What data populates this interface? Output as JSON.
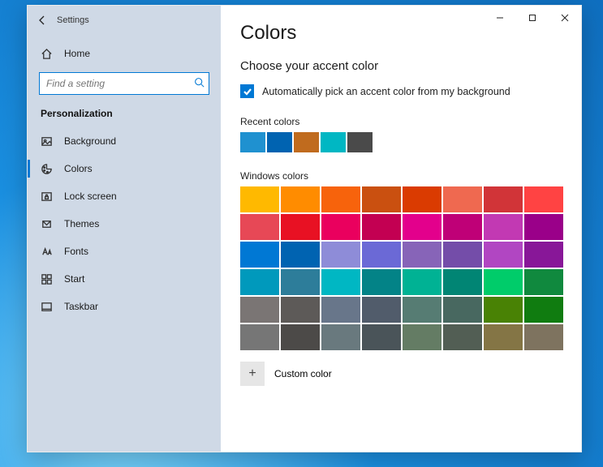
{
  "window": {
    "title": "Settings"
  },
  "sidebar": {
    "home": "Home",
    "search_placeholder": "Find a setting",
    "section": "Personalization",
    "items": [
      {
        "label": "Background"
      },
      {
        "label": "Colors"
      },
      {
        "label": "Lock screen"
      },
      {
        "label": "Themes"
      },
      {
        "label": "Fonts"
      },
      {
        "label": "Start"
      },
      {
        "label": "Taskbar"
      }
    ]
  },
  "page": {
    "heading": "Colors",
    "subheading": "Choose your accent color",
    "auto_pick_label": "Automatically pick an accent color from my background",
    "auto_pick_checked": true,
    "recent_label": "Recent colors",
    "recent_colors": [
      "#1f91d0",
      "#0063b1",
      "#c06b1e",
      "#00b7c3",
      "#4a4a4a"
    ],
    "windows_label": "Windows colors",
    "windows_colors": [
      "#ffb900",
      "#ff8c00",
      "#f7630c",
      "#ca5010",
      "#da3b01",
      "#ef6950",
      "#d13438",
      "#ff4343",
      "#e74856",
      "#e81123",
      "#ea005e",
      "#c30052",
      "#e3008c",
      "#bf0077",
      "#c239b3",
      "#9a0089",
      "#0078d4",
      "#0063b1",
      "#8e8cd8",
      "#6b69d6",
      "#8764b8",
      "#744da9",
      "#b146c2",
      "#881798",
      "#0099bc",
      "#2d7d9a",
      "#00b7c3",
      "#038387",
      "#00b294",
      "#018574",
      "#00cc6a",
      "#10893e",
      "#7a7574",
      "#5d5a58",
      "#68768a",
      "#515c6b",
      "#567c73",
      "#486860",
      "#498205",
      "#107c10",
      "#767676",
      "#4c4a48",
      "#69797e",
      "#4a5459",
      "#647c64",
      "#525e54",
      "#847545",
      "#7e735f"
    ],
    "custom_label": "Custom color"
  }
}
